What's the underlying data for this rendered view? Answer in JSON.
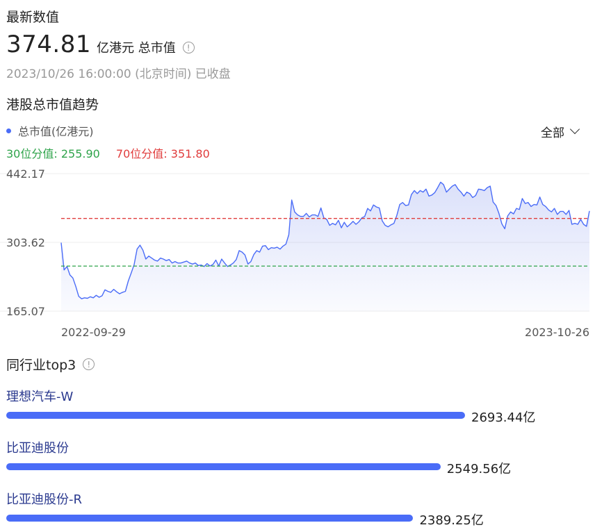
{
  "header": {
    "latest_label": "最新数值",
    "value": "374.81",
    "unit": "亿港元 总市值",
    "info_icon": "info-icon",
    "timestamp": "2023/10/26 16:00:00 (北京时间) 已收盘"
  },
  "trend": {
    "title": "港股总市值趋势",
    "legend": "总市值(亿港元)",
    "range": "全部",
    "pct30_text": "30位分值: 255.90",
    "pct70_text": "70位分值: 351.80"
  },
  "chart_data": {
    "type": "area",
    "y_ticks": [
      "442.17",
      "303.62",
      "165.07"
    ],
    "x_ticks": [
      "2022-09-29",
      "2023-10-26"
    ],
    "ylim": [
      165.07,
      442.17
    ],
    "y_tick_values": [
      442.17,
      303.62,
      165.07
    ],
    "reference_lines": [
      {
        "label": "30位分值",
        "value": 255.9,
        "color": "#2ea34a"
      },
      {
        "label": "70位分值",
        "value": 351.8,
        "color": "#e03c3c"
      }
    ],
    "series": [
      {
        "color": "#4a6cf7",
        "values": [
          303,
          248,
          255,
          238,
          232,
          215,
          195,
          190,
          192,
          191,
          194,
          192,
          197,
          193,
          196,
          208,
          205,
          203,
          209,
          204,
          200,
          203,
          205,
          226,
          242,
          259,
          290,
          298,
          288,
          270,
          276,
          272,
          268,
          266,
          272,
          270,
          267,
          269,
          262,
          265,
          262,
          262,
          264,
          266,
          262,
          260,
          262,
          257,
          258,
          255,
          261,
          256,
          259,
          268,
          256,
          270,
          262,
          255,
          258,
          262,
          269,
          287,
          284,
          278,
          260,
          265,
          279,
          287,
          284,
          296,
          297,
          289,
          293,
          292,
          294,
          290,
          296,
          300,
          319,
          389,
          365,
          359,
          356,
          356,
          362,
          355,
          359,
          359,
          356,
          373,
          353,
          350,
          338,
          342,
          339,
          348,
          333,
          344,
          335,
          340,
          346,
          340,
          345,
          353,
          356,
          372,
          367,
          379,
          375,
          373,
          347,
          338,
          335,
          339,
          342,
          358,
          380,
          384,
          378,
          379,
          400,
          408,
          402,
          408,
          405,
          411,
          397,
          399,
          404,
          414,
          425,
          420,
          405,
          411,
          417,
          420,
          411,
          405,
          397,
          405,
          402,
          394,
          398,
          411,
          410,
          408,
          414,
          417,
          385,
          378,
          362,
          341,
          331,
          357,
          365,
          361,
          372,
          370,
          392,
          382,
          384,
          376,
          380,
          379,
          395,
          380,
          376,
          369,
          365,
          372,
          360,
          366,
          366,
          360,
          368,
          340,
          342,
          340,
          350,
          340,
          336,
          367
        ]
      }
    ]
  },
  "peers": {
    "title": "同行业top3",
    "info_icon": "info-icon",
    "items": [
      {
        "name": "理想汽车-W",
        "value": 2693.44,
        "label": "2693.44亿"
      },
      {
        "name": "比亚迪股份",
        "value": 2549.56,
        "label": "2549.56亿"
      },
      {
        "name": "比亚迪股份-R",
        "value": 2389.25,
        "label": "2389.25亿"
      }
    ]
  }
}
